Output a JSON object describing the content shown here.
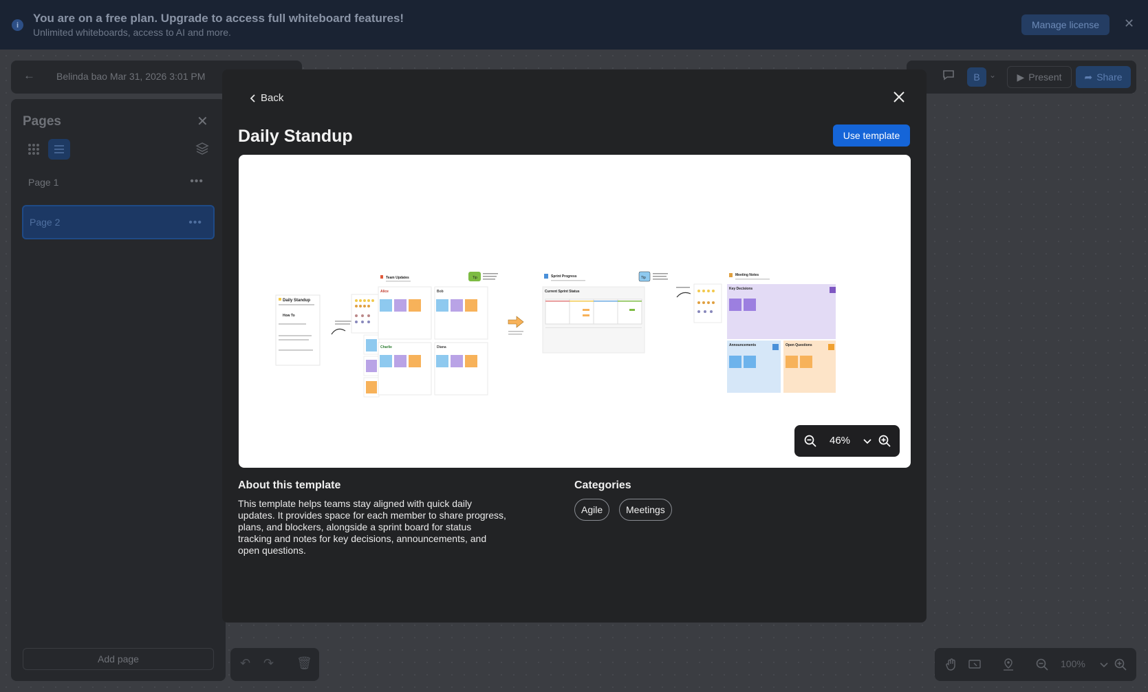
{
  "banner": {
    "title": "You are on a free plan. Upgrade to access full whiteboard features!",
    "subtitle": "Unlimited whiteboards, access to AI and more.",
    "manage_label": "Manage license"
  },
  "topbar": {
    "doc_title": "Belinda bao Mar 31, 2026 3:01 PM",
    "avatar_initial": "B",
    "present_label": "Present",
    "share_label": "Share"
  },
  "pages": {
    "title": "Pages",
    "items": [
      {
        "label": "Page 1",
        "active": false
      },
      {
        "label": "Page 2",
        "active": true
      }
    ],
    "add_label": "Add page"
  },
  "canvas_zoom": "100%",
  "modal": {
    "back_label": "Back",
    "title": "Daily Standup",
    "use_label": "Use template",
    "preview_zoom": "46%",
    "about_heading": "About this template",
    "about_text": "This template helps teams stay aligned with quick daily updates. It provides space for each member to share progress, plans, and blockers, alongside a sprint board for status tracking and notes for key decisions, announcements, and open questions.",
    "categories_heading": "Categories",
    "categories": [
      "Agile",
      "Meetings"
    ]
  },
  "preview_board": {
    "intro_title": "Daily Standup",
    "how_to": "How To",
    "team_updates": "Team Updates",
    "tip1": "Tip",
    "members": [
      "Alice",
      "Bob",
      "Charlie",
      "Diana"
    ],
    "sprint_progress": "Sprint Progress",
    "current_status": "Current Sprint Status",
    "tip2": "Tip",
    "meeting_notes": "Meeting Notes",
    "key_decisions": "Key Decisions",
    "announcements": "Announcements",
    "open_questions": "Open Questions"
  },
  "colors": {
    "accent": "#1565d8",
    "sticky_blue": "#8ec9ef",
    "sticky_purple": "#b9a3e6",
    "sticky_orange": "#f7b25a",
    "decisions_bg": "#e3dbf5",
    "announce_bg": "#d6e7f8",
    "questions_bg": "#fde4c8"
  }
}
